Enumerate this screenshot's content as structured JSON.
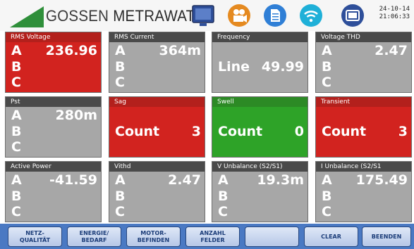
{
  "header": {
    "brand_part1": "GOSSEN",
    "brand_part2": "METRAWATT",
    "date": "24-10-14",
    "time": "21:06:33",
    "icons": [
      "monitor-icon",
      "camera-icon",
      "document-icon",
      "wifi-icon",
      "tablet-icon"
    ]
  },
  "tiles": [
    {
      "title": "RMS Voltage",
      "a": "A",
      "b": "B",
      "c": "C",
      "a_val": "236.96"
    },
    {
      "title": "RMS Current",
      "a": "A",
      "b": "B",
      "c": "C",
      "a_val": "364m"
    },
    {
      "title": "Frequency",
      "label": "Line",
      "value": "49.99"
    },
    {
      "title": "Voltage THD",
      "a": "A",
      "b": "B",
      "c": "C",
      "a_val": "2.47"
    },
    {
      "title": "Pst",
      "a": "A",
      "b": "B",
      "c": "C",
      "a_val": "280m"
    },
    {
      "title": "Sag",
      "label": "Count",
      "value": "3"
    },
    {
      "title": "Swell",
      "label": "Count",
      "value": "0"
    },
    {
      "title": "Transient",
      "label": "Count",
      "value": "3"
    },
    {
      "title": "Active Power",
      "a": "A",
      "b": "B",
      "c": "C",
      "a_val": "-41.59"
    },
    {
      "title": "Vithd",
      "a": "A",
      "b": "B",
      "c": "C",
      "a_val": "2.47"
    },
    {
      "title": "V Unbalance (S2/S1)",
      "a": "A",
      "b": "B",
      "c": "C",
      "a_val": "19.3m"
    },
    {
      "title": "I Unbalance (S2/S1",
      "a": "A",
      "b": "B",
      "c": "C",
      "a_val": "175.49"
    }
  ],
  "buttons": [
    {
      "line1": "NETZ-",
      "line2": "QUALITÄT"
    },
    {
      "line1": "ENERGIE/",
      "line2": "BEDARF"
    },
    {
      "line1": "MOTOR-",
      "line2": "BEFINDEN"
    },
    {
      "line1": "ANZAHL",
      "line2": "FELDER"
    },
    {
      "line1": "",
      "line2": ""
    },
    {
      "line1": "CLEAR",
      "line2": ""
    },
    {
      "line1": "BEENDEN",
      "line2": ""
    }
  ],
  "colors": {
    "alarm_red": "#d2231f",
    "ok_green": "#2ea328",
    "tile_grey": "#a7a7a7",
    "bar_blue": "#4a79c3",
    "logo_green": "#2f8f3a"
  }
}
